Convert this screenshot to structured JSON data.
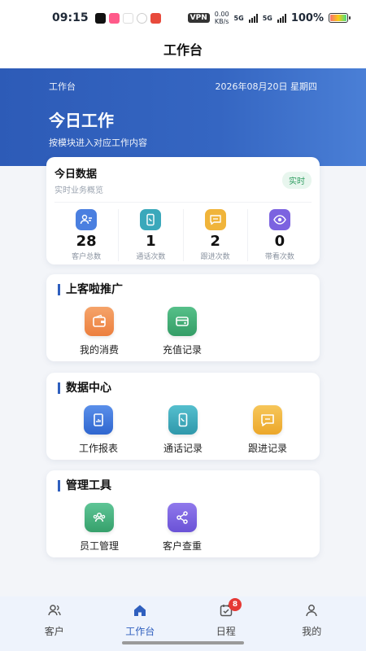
{
  "status_bar": {
    "time": "09:15",
    "vpn": "VPN",
    "net_speed_value": "0.00",
    "net_speed_unit": "KB/s",
    "signal1": "5G",
    "signal2": "5G",
    "battery": "100%"
  },
  "navbar": {
    "title": "工作台"
  },
  "hero": {
    "label": "工作台",
    "date": "2026年08月20日 星期四",
    "title": "今日工作",
    "subtitle": "按模块进入对应工作内容"
  },
  "today": {
    "title": "今日数据",
    "subtitle": "实时业务概览",
    "badge": "实时",
    "stats": [
      {
        "value": "28",
        "label": "客户总数",
        "icon": "user-profile-icon",
        "color": "#4a7fe0"
      },
      {
        "value": "1",
        "label": "通话次数",
        "icon": "phone-icon",
        "color": "#3aa8bb"
      },
      {
        "value": "2",
        "label": "跟进次数",
        "icon": "message-icon",
        "color": "#f0b43a"
      },
      {
        "value": "0",
        "label": "带看次数",
        "icon": "eye-icon",
        "color": "#7c63e0"
      }
    ]
  },
  "sections": [
    {
      "title": "上客啦推广",
      "items": [
        {
          "label": "我的消费",
          "icon": "wallet-icon",
          "color": "#ef8a4a"
        },
        {
          "label": "充值记录",
          "icon": "card-icon",
          "color": "#3daa72"
        }
      ]
    },
    {
      "title": "数据中心",
      "items": [
        {
          "label": "工作报表",
          "icon": "report-icon",
          "color": "#3b78de"
        },
        {
          "label": "通话记录",
          "icon": "phone-icon",
          "color": "#3aa8bb"
        },
        {
          "label": "跟进记录",
          "icon": "message-icon",
          "color": "#f0b43a"
        }
      ]
    },
    {
      "title": "管理工具",
      "items": [
        {
          "label": "员工管理",
          "icon": "team-icon",
          "color": "#3daa72"
        },
        {
          "label": "客户查重",
          "icon": "share-icon",
          "color": "#7c63e0"
        }
      ]
    }
  ],
  "tabbar": {
    "tabs": [
      {
        "label": "客户",
        "icon": "customers-icon"
      },
      {
        "label": "工作台",
        "icon": "home-icon"
      },
      {
        "label": "日程",
        "icon": "schedule-icon",
        "badge": "8"
      },
      {
        "label": "我的",
        "icon": "profile-icon"
      }
    ],
    "active_index": 1
  }
}
